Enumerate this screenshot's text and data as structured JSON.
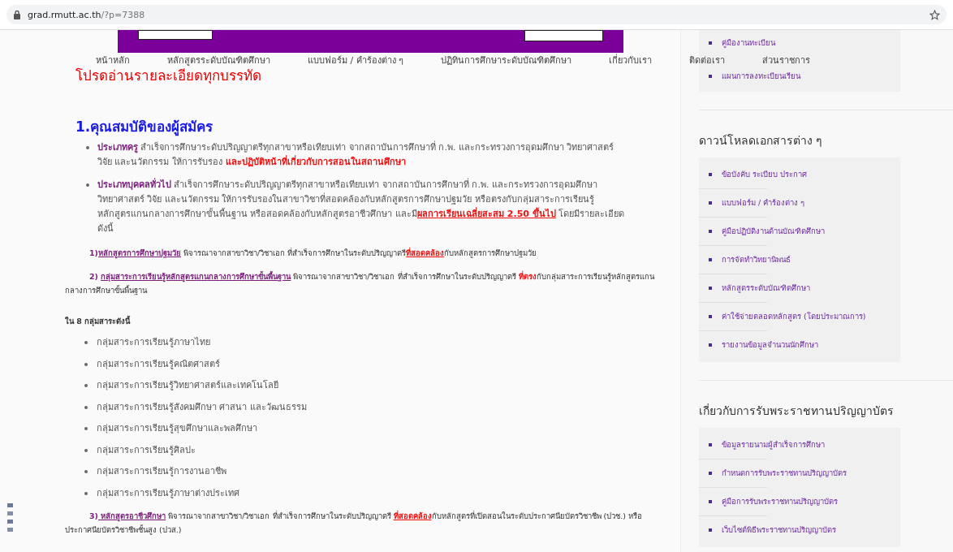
{
  "browser": {
    "url_host": "grad.rmutt.ac.th",
    "url_path": "/?p=7388"
  },
  "nav": {
    "items": [
      "หน้าหลัก",
      "หลักสูตรระดับบัณฑิตศึกษา",
      "แบบฟอร์ม / คำร้องต่าง ๆ",
      "ปฏิทินการศึกษาระดับบัณฑิตศึกษา",
      "เกี่ยวกับเรา",
      "ติดต่อเรา",
      "ส่วนราชการ"
    ]
  },
  "content": {
    "notice": "โปรดอ่านรายละเอียดทุกบรรทัด",
    "heading": "1.คุณสมบัติของผู้สมัคร",
    "bullets": [
      {
        "segments": [
          {
            "kind": "bold",
            "text": "ประเภทครู"
          },
          {
            "kind": "plain",
            "text": " สำเร็จการศึกษาระดับปริญญาตรีทุกสาขาหรือเทียบเท่า จากสถาบันการศึกษาที่ ก.พ. และกระทรวงการอุดมศึกษา วิทยาศาสตร์ วิจัย และนวัตกรรม ให้การรับรอง "
          },
          {
            "kind": "red",
            "text": "และปฏิบัติหน้าที่เกี่ยวกับการสอนในสถานศึกษา"
          }
        ]
      },
      {
        "segments": [
          {
            "kind": "bold",
            "text": "ประเภทบุคคลทั่วไป"
          },
          {
            "kind": "plain",
            "text": " สำเร็จการศึกษาระดับปริญญาตรีทุกสาขาหรือเทียบเท่า จากสถาบันการศึกษาที่ ก.พ. และกระทรวงการอุดมศึกษา วิทยาศาสตร์ วิจัย และนวัตกรรม ให้การรับรองในสาขาวิชาที่สอดคล้องกับหลักสูตรการศึกษาปฐมวัย หรือตรงกับกลุ่มสาระการเรียนรู้หลักสูตรแกนกลางการศึกษาขั้นพื้นฐาน หรือสอดคล้องกับหลักสูตรอาชีวศึกษา และมี"
          },
          {
            "kind": "redlink",
            "text": "ผลการเรียนเฉลี่ยสะสม 2.50 ขึ้นไป"
          },
          {
            "kind": "plain",
            "text": "  โดยมีรายละเอียดดังนี้"
          }
        ]
      }
    ],
    "clauses_a": [
      {
        "segments": [
          {
            "kind": "bold",
            "text": "1)"
          },
          {
            "kind": "link",
            "text": "หลักสูตรการศึกษาปฐมวัย"
          },
          {
            "kind": "plain",
            "text": " พิจารณาจากสาขาวิชา/วิชาเอก ที่สำเร็จการศึกษาในระดับปริญญาตรี"
          },
          {
            "kind": "redlink",
            "text": "ที่สอดคล้อง"
          },
          {
            "kind": "plain",
            "text": "กับหลักสูตรการศึกษาปฐมวัย"
          }
        ]
      },
      {
        "segments": [
          {
            "kind": "bold",
            "text": "2) "
          },
          {
            "kind": "link",
            "text": "กลุ่มสาระการเรียนรู้หลักสูตรแกนกลางการศึกษาขั้นพื้นฐาน"
          },
          {
            "kind": "plain",
            "text": " พิจารณาจากสาขาวิชา/วิชาเอก ที่สำเร็จการศึกษาในระดับปริญญาตรี "
          },
          {
            "kind": "red",
            "text": "ที่ตรง"
          },
          {
            "kind": "plain",
            "text": "กับกลุ่มสาระการเรียนรู้หลักสูตรแกนกลางการศึกษาขั้นพื้นฐาน"
          }
        ]
      }
    ],
    "groups_label": "ใน 8 กลุ่มสาระดังนี้",
    "groups": [
      "กลุ่มสาระการเรียนรู้ภาษาไทย",
      "กลุ่มสาระการเรียนรู้คณิตศาสตร์",
      "กลุ่มสาระการเรียนรู้วิทยาศาสตร์และเทคโนโลยี",
      "กลุ่มสาระการเรียนรู้สังคมศึกษา ศาสนา และวัฒนธรรม",
      "กลุ่มสาระการเรียนรู้สุขศึกษาและพลศึกษา",
      "กลุ่มสาระการเรียนรู้ศิลปะ",
      "กลุ่มสาระการเรียนรู้การงานอาชีพ",
      "กลุ่มสาระการเรียนรู้ภาษาต่างประเทศ"
    ],
    "clauses_b": [
      {
        "segments": [
          {
            "kind": "bold",
            "text": "3)"
          },
          {
            "kind": "link",
            "text": " หลักสูตรอาชีวศึกษา"
          },
          {
            "kind": "plain",
            "text": " พิจารณาจากสาขาวิชา/วิชาเอก ที่สำเร็จการศึกษาในระดับปริญญาตรี "
          },
          {
            "kind": "redlink",
            "text": "ที่สอดคล้อง"
          },
          {
            "kind": "plain",
            "text": "กับหลักสูตรที่เปิดสอนในระดับประกาศนียบัตรวิชาชีพ (ปวช.) หรือประกาศนียบัตรวิชาชีพชั้นสูง (ปวส.)"
          }
        ]
      }
    ]
  },
  "sidebar": {
    "widgets": [
      {
        "items": [
          "คู่มืองานทะเบียน",
          "แผนการลงทะเบียนเรียน"
        ]
      },
      {
        "title": "ดาวน์โหลดเอกสารต่าง ๆ",
        "items": [
          "ข้อบังคับ ระเบียบ ประกาศ",
          "แบบฟอร์ม / คำร้องต่าง ๆ",
          "คู่มือปฏิบัติงานด้านบัณฑิตศึกษา",
          "การจัดทำวิทยานิพนธ์",
          "หลักสูตรระดับบัณฑิตศึกษา",
          "ค่าใช้จ่ายตลอดหลักสูตร (โดยประมาณการ)",
          "รายงานข้อมูลจำนวนนักศึกษา"
        ]
      },
      {
        "title": "เกี่ยวกับการรับพระราชทานปริญญาบัตร",
        "items": [
          "ข้อมูลรายนามผู้สำเร็จการศึกษา",
          "กำหนดการรับพระราชทานปริญญาบัตร",
          "คู่มือการรับพระราชทานปริญญาบัตร",
          "เว็บไซต์พิธีพระราชทานปริญญาบัตร"
        ]
      }
    ]
  }
}
